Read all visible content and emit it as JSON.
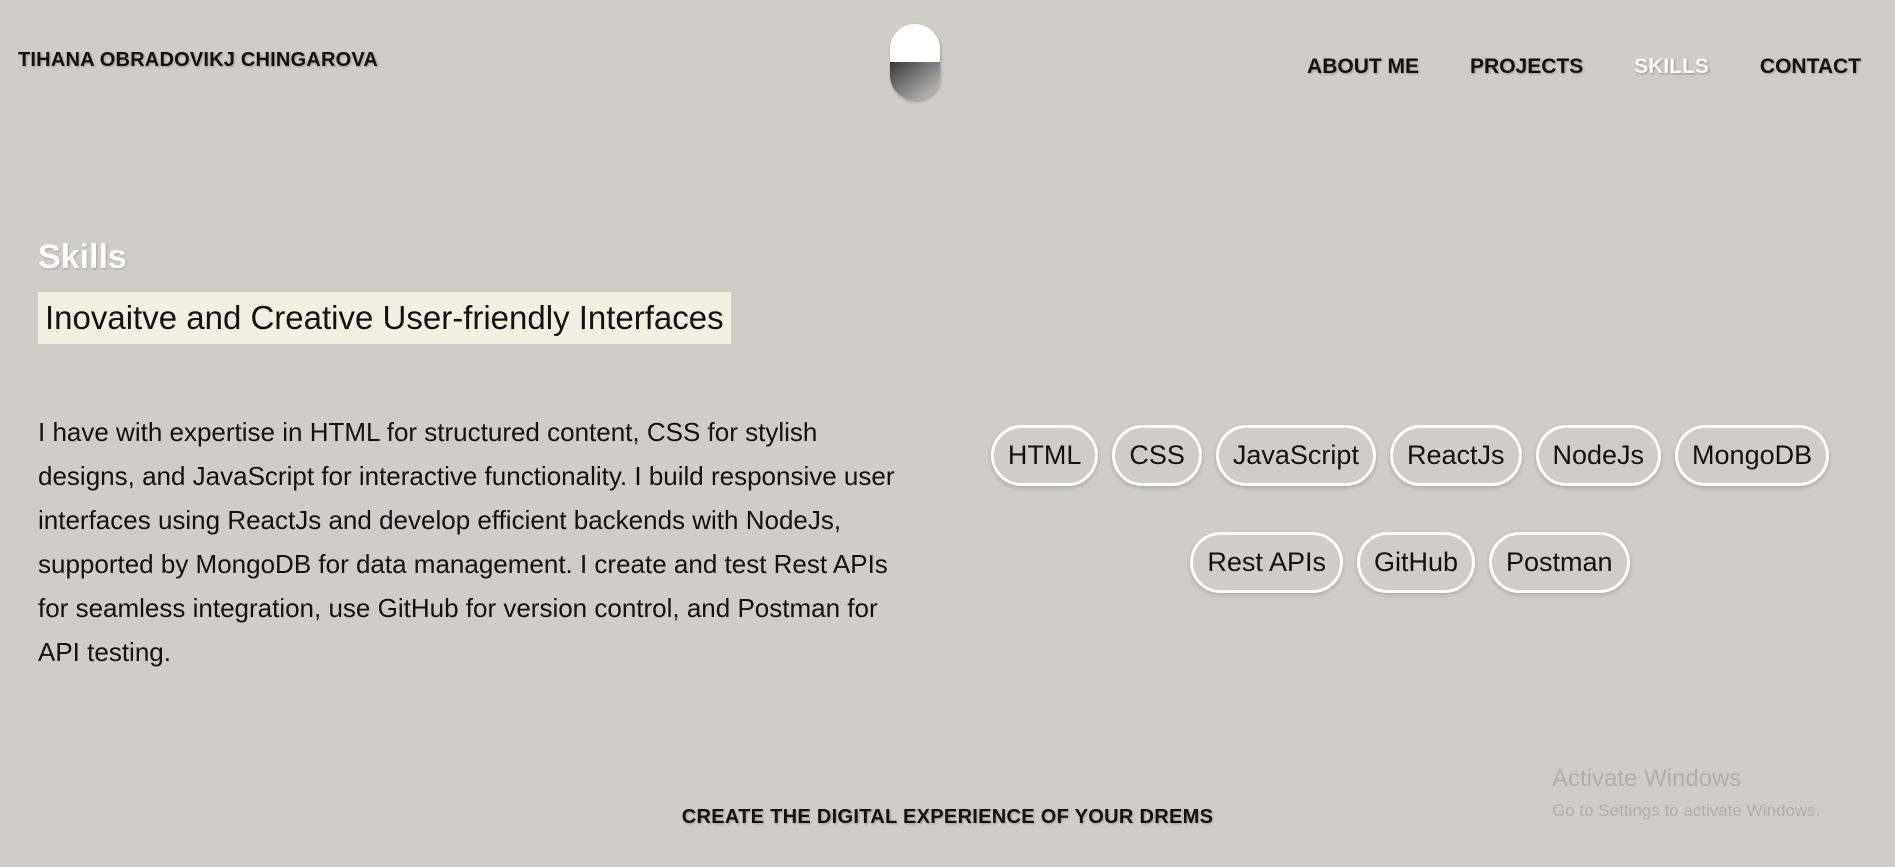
{
  "header": {
    "brand": "TIHANA OBRADOVIKJ CHINGAROVA",
    "logo_icon": "half-circle-logo-icon",
    "nav": [
      {
        "label": "ABOUT ME",
        "active": false
      },
      {
        "label": "PROJECTS",
        "active": false
      },
      {
        "label": "SKILLS",
        "active": true
      },
      {
        "label": "CONTACT",
        "active": false
      }
    ]
  },
  "skills": {
    "title": "Skills",
    "subtitle": "Inovaitve and Creative User-friendly Interfaces",
    "description": "I have with expertise in HTML for structured content, CSS for stylish designs, and JavaScript for interactive functionality. I build responsive user interfaces using ReactJs and develop efficient backends with NodeJs, supported by MongoDB for data management. I create and test Rest APIs for seamless integration, use GitHub for version control, and Postman for API testing.",
    "tags": [
      "HTML",
      "CSS",
      "JavaScript",
      "ReactJs",
      "NodeJs",
      "MongoDB",
      "Rest APIs",
      "GitHub",
      "Postman"
    ]
  },
  "footer": {
    "tagline": "CREATE THE DIGITAL EXPERIENCE OF YOUR DREMS"
  },
  "watermark": {
    "title": "Activate Windows",
    "subtitle": "Go to Settings to activate Windows."
  },
  "colors": {
    "background": "#d0cdc8",
    "highlight": "#f3efe1",
    "active_nav": "#ffffff",
    "pill_border": "#ffffff"
  }
}
